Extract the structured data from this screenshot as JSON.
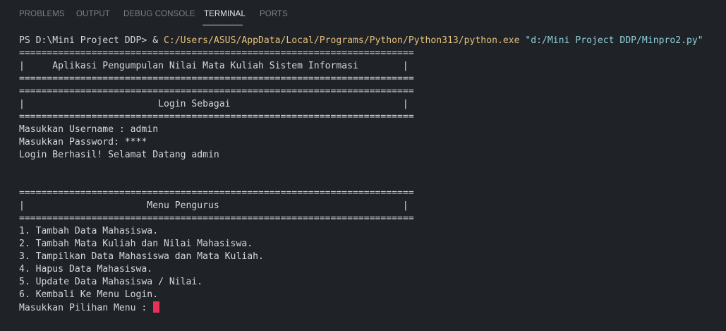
{
  "panel": {
    "tabs": [
      {
        "label": "PROBLEMS"
      },
      {
        "label": "OUTPUT"
      },
      {
        "label": "DEBUG CONSOLE"
      },
      {
        "label": "TERMINAL"
      },
      {
        "label": "PORTS"
      }
    ],
    "active_tab": "TERMINAL"
  },
  "terminal": {
    "prompt": "PS D:\\Mini Project DDP> & ",
    "exe_path": "C:/Users/ASUS/AppData/Local/Programs/Python/Python313/python.exe",
    "script_arg": "\"d:/Mini Project DDP/Minpro2.py\"",
    "lines": [
      "=======================================================================",
      "|     Aplikasi Pengumpulan Nilai Mata Kuliah Sistem Informasi        |",
      "=======================================================================",
      "=======================================================================",
      "|                        Login Sebagai                               |",
      "=======================================================================",
      "Masukkan Username : admin",
      "Masukkan Password: ****",
      "Login Berhasil! Selamat Datang admin",
      "",
      "",
      "=======================================================================",
      "|                      Menu Pengurus                                 |",
      "=======================================================================",
      "1. Tambah Data Mahasiswa.",
      "2. Tambah Mata Kuliah dan Nilai Mahasiswa.",
      "3. Tampilkan Data Mahasiswa dan Mata Kuliah.",
      "4. Hapus Data Mahasiswa.",
      "5. Update Data Mahasiswa / Nilai.",
      "6. Kembali Ke Menu Login."
    ],
    "input_prompt": "Masukkan Pilihan Menu : "
  },
  "colors": {
    "background": "#1f2227",
    "text": "#d4d7dc",
    "path_yellow": "#e5c07b",
    "arg_cyan": "#8fd0d8",
    "cursor": "#e8315a"
  }
}
